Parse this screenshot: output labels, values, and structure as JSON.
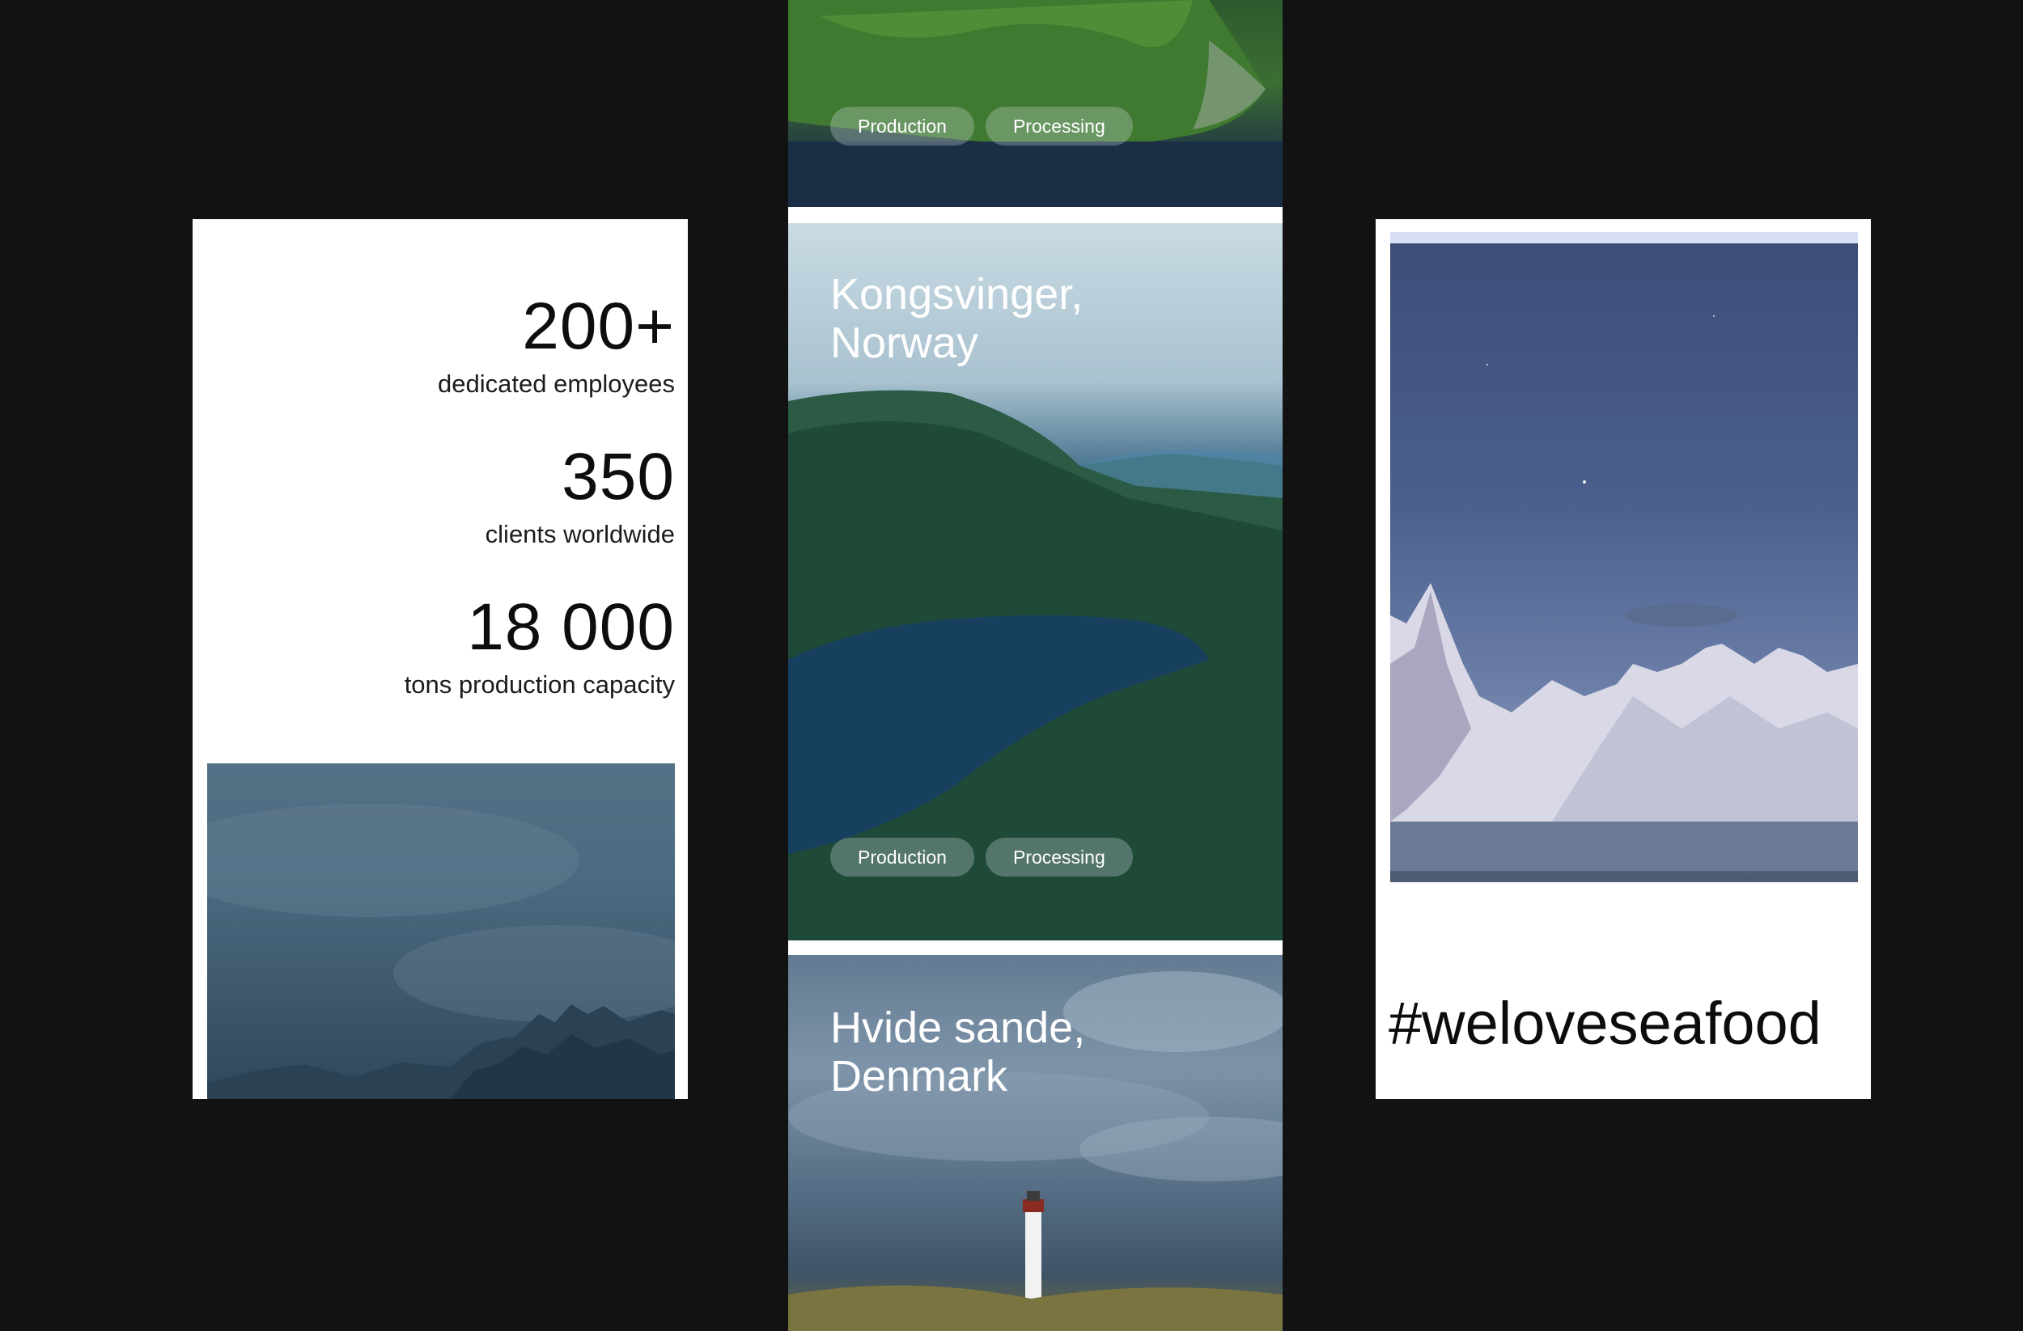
{
  "stats": [
    {
      "value": "200+",
      "label": "dedicated employees"
    },
    {
      "value": "350",
      "label": "clients worldwide"
    },
    {
      "value": "18 000",
      "label": "tons production capacity"
    }
  ],
  "locations": [
    {
      "title": "",
      "tags": [
        "Production",
        "Processing"
      ]
    },
    {
      "title": "Kongsvinger,\nNorway",
      "tags": [
        "Production",
        "Processing"
      ]
    },
    {
      "title": "Hvide sande,\nDenmark",
      "tags": []
    }
  ],
  "hashtag": "#weloveseafood",
  "colors": {
    "background": "#121212",
    "panel": "#ffffff",
    "text": "#0d0d0d",
    "tag_bg": "rgba(210,218,224,0.30)"
  }
}
